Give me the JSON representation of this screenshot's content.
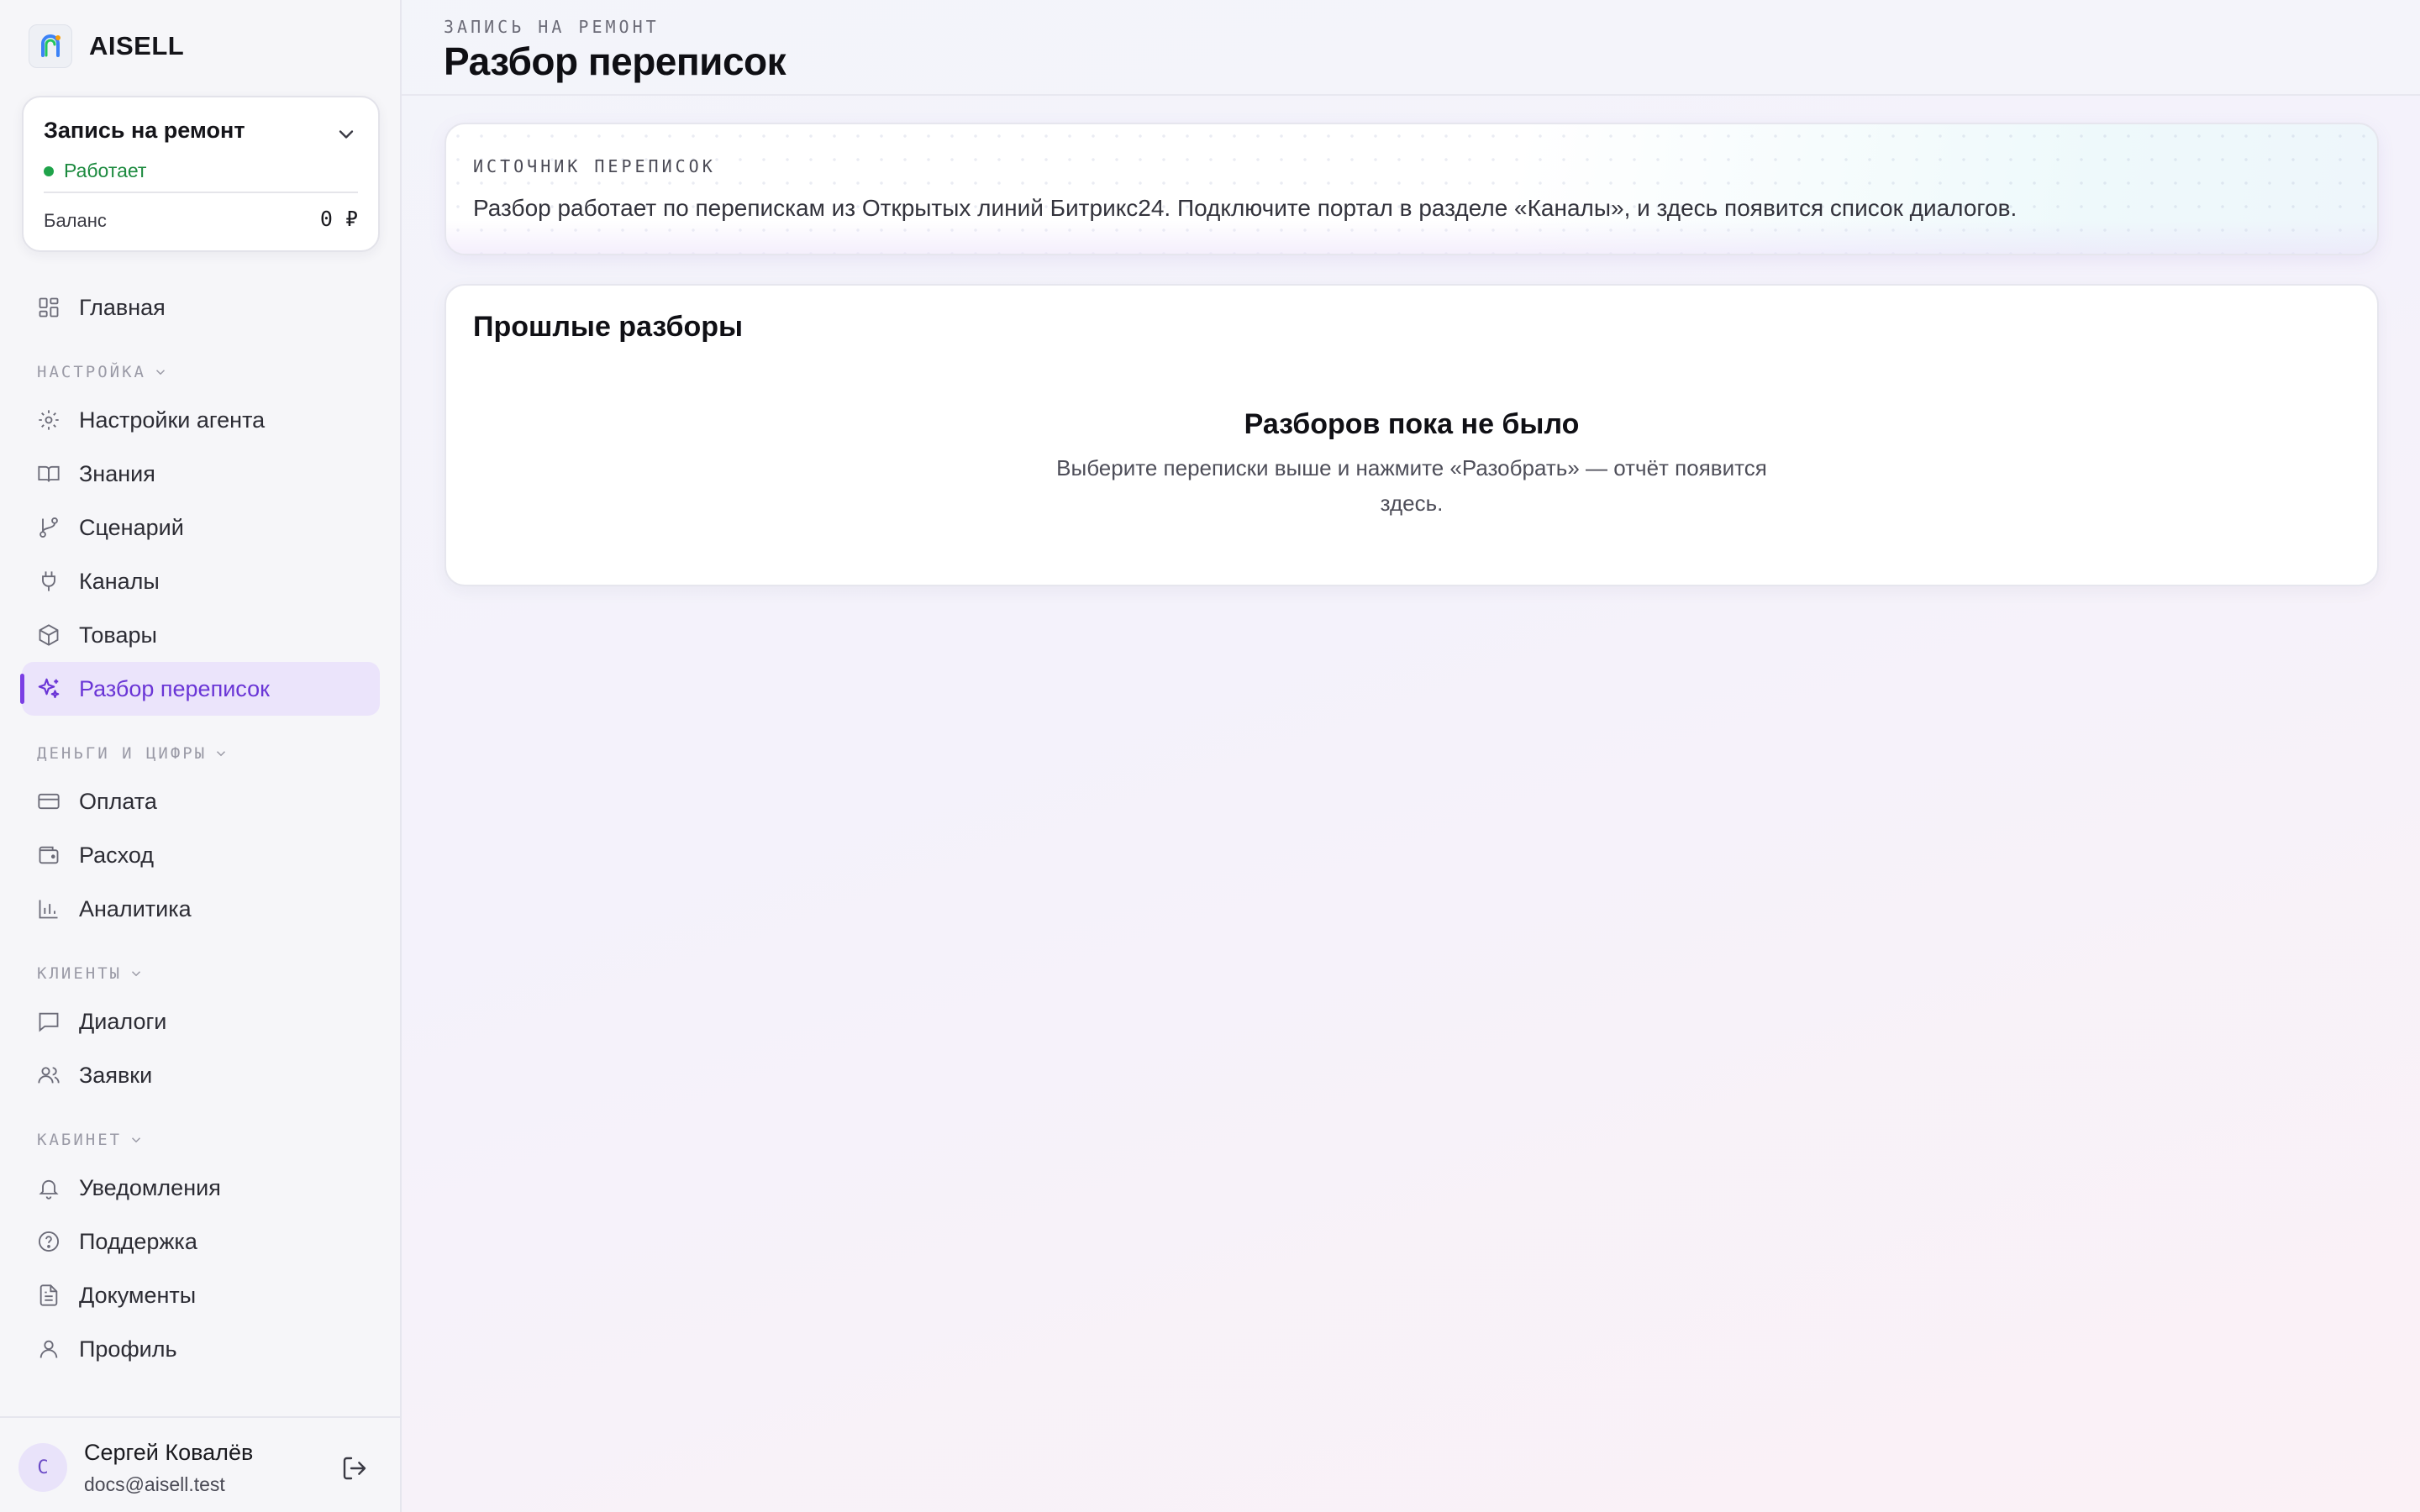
{
  "brand": {
    "name": "AISELL"
  },
  "agent": {
    "name": "Запись на ремонт",
    "status": "Работает",
    "balance_label": "Баланс",
    "balance_value": "0 ₽"
  },
  "nav": {
    "home": "Главная",
    "sections": {
      "settings": "НАСТРОЙКА",
      "money": "ДЕНЬГИ И ЦИФРЫ",
      "clients": "КЛИЕНТЫ",
      "cabinet": "КАБИНЕТ"
    },
    "items": {
      "agent_settings": "Настройки агента",
      "knowledge": "Знания",
      "scenario": "Сценарий",
      "channels": "Каналы",
      "products": "Товары",
      "chat_analysis": "Разбор переписок",
      "payment": "Оплата",
      "expense": "Расход",
      "analytics": "Аналитика",
      "dialogs": "Диалоги",
      "requests": "Заявки",
      "notifications": "Уведомления",
      "support": "Поддержка",
      "documents": "Документы",
      "profile": "Профиль"
    },
    "active": "chat_analysis"
  },
  "user": {
    "initial": "С",
    "name": "Сергей Ковалёв",
    "email": "docs@aisell.test"
  },
  "header": {
    "eyebrow": "ЗАПИСЬ НА РЕМОНТ",
    "title": "Разбор переписок"
  },
  "source": {
    "label": "ИСТОЧНИК ПЕРЕПИСОК",
    "text": "Разбор работает по перепискам из Открытых линий Битрикс24. Подключите портал в разделе «Каналы», и здесь появится список диалогов."
  },
  "history": {
    "title": "Прошлые разборы",
    "empty_title": "Разборов пока не было",
    "empty_text": "Выберите переписки выше и нажмите «Разобрать» — отчёт появится здесь."
  },
  "colors": {
    "accent": "#7b3fe4",
    "active_bg": "#ebe4fb",
    "status_green": "#1fa34a"
  }
}
